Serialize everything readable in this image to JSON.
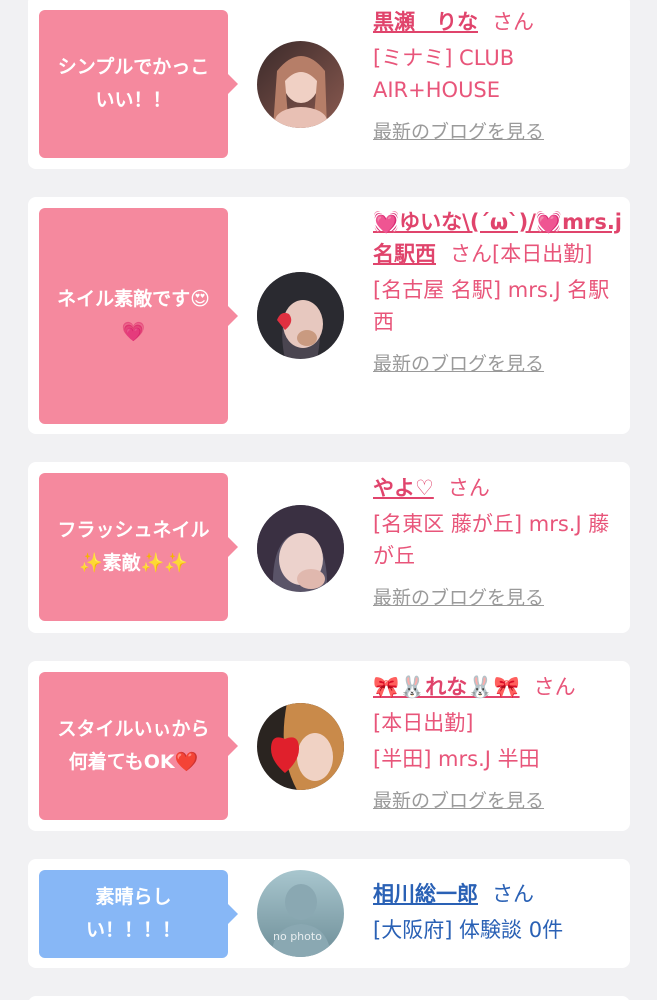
{
  "cards": [
    {
      "comment": "シンプルでかっこいい！！",
      "name": "黒瀬　りな",
      "honorific": "さん",
      "shop": "[ミナミ] CLUB AIR+HOUSE",
      "blog": "最新のブログを見る"
    },
    {
      "comment": "ネイル素敵です😍💗",
      "name": "💓ゆいな\\(´ω`)/💓mrs.j名駅西",
      "honorific": "さん[本日出勤]",
      "shop": "[名古屋 名駅] mrs.J 名駅西",
      "blog": "最新のブログを見る"
    },
    {
      "comment": "フラッシュネイル✨素敵✨✨",
      "name": "やよ♡",
      "honorific": "さん",
      "shop": "[名東区 藤が丘] mrs.J 藤が丘",
      "blog": "最新のブログを見る"
    },
    {
      "comment": "スタイルいぃから何着てもOK❤️",
      "name": "🎀🐰れな🐰🎀",
      "honorific": "さん",
      "status": "[本日出勤]",
      "shop": "[半田] mrs.J 半田",
      "blog": "最新のブログを見る"
    },
    {
      "comment": "素晴らしい！！！！",
      "name": "相川総一郎",
      "honorific": "さん",
      "shop": "[大阪府] 体験談 0件",
      "avatar_text": "no photo"
    }
  ],
  "colors": {
    "bubble_pink": "#f5899e",
    "bubble_blue": "#87b7f6",
    "name_pink": "#e0446c",
    "name_blue": "#2a61b5",
    "link_gray": "#9a9a9a"
  }
}
